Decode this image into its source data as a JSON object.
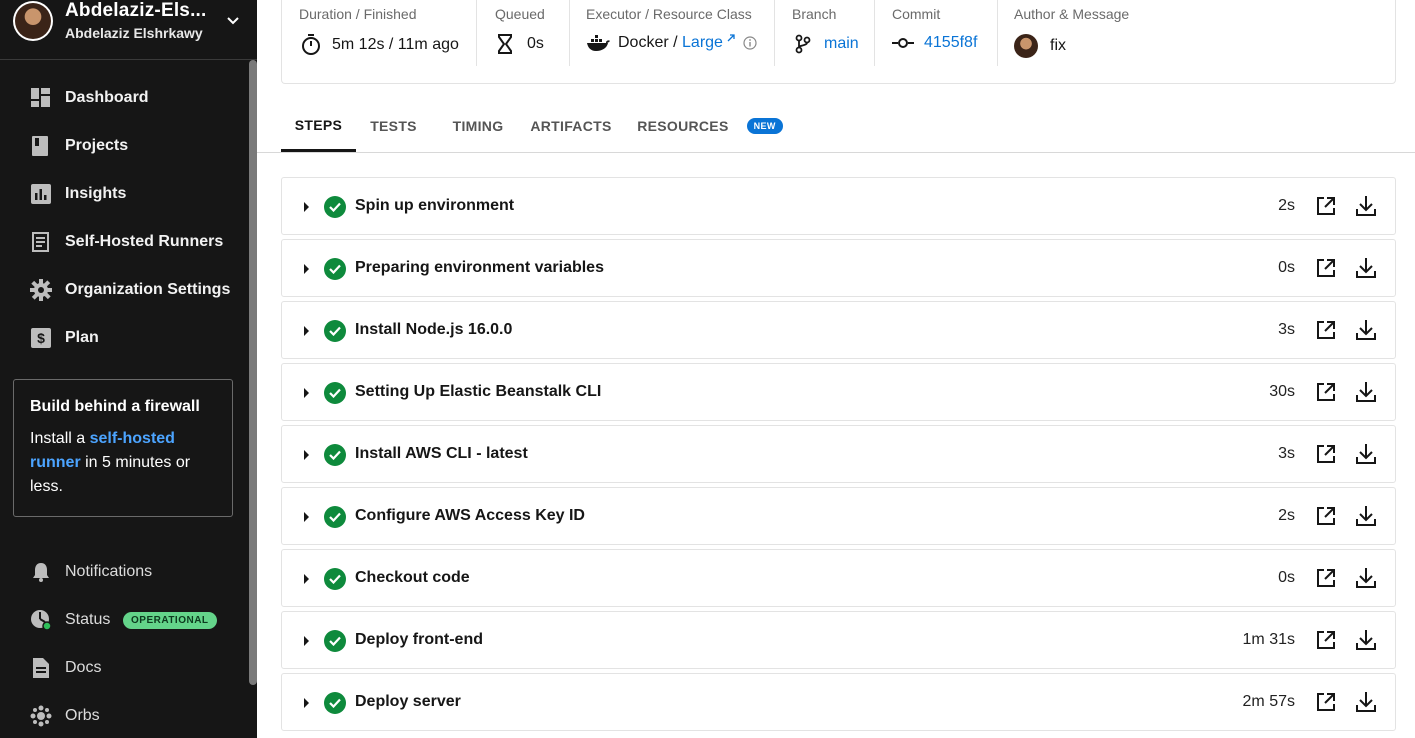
{
  "org": {
    "name": "Abdelaziz-Els...",
    "user": "Abdelaziz Elshrkawy"
  },
  "nav": [
    {
      "label": "Dashboard",
      "icon": "dashboard-icon"
    },
    {
      "label": "Projects",
      "icon": "projects-icon"
    },
    {
      "label": "Insights",
      "icon": "insights-icon"
    },
    {
      "label": "Self-Hosted Runners",
      "icon": "runners-icon"
    },
    {
      "label": "Organization Settings",
      "icon": "gear-icon"
    },
    {
      "label": "Plan",
      "icon": "dollar-icon"
    }
  ],
  "promo": {
    "heading": "Build behind a firewall",
    "text_before": "Install a ",
    "link": "self-hosted runner",
    "text_after": " in 5 minutes or less."
  },
  "bottom_nav": [
    {
      "label": "Notifications",
      "icon": "bell-icon"
    },
    {
      "label": "Status",
      "icon": "status-icon",
      "badge": "OPERATIONAL"
    },
    {
      "label": "Docs",
      "icon": "docs-icon"
    },
    {
      "label": "Orbs",
      "icon": "orbs-icon"
    }
  ],
  "info": {
    "duration": {
      "label": "Duration / Finished",
      "value": "5m 12s / 11m ago"
    },
    "queued": {
      "label": "Queued",
      "value": "0s"
    },
    "executor": {
      "label": "Executor / Resource Class",
      "executor": "Docker",
      "slash": " / ",
      "resource": "Large"
    },
    "branch": {
      "label": "Branch",
      "value": "main"
    },
    "commit": {
      "label": "Commit",
      "value": "4155f8f"
    },
    "author": {
      "label": "Author & Message",
      "message": "fix"
    }
  },
  "tabs": [
    {
      "label": "STEPS",
      "active": true
    },
    {
      "label": "TESTS"
    },
    {
      "label": "TIMING"
    },
    {
      "label": "ARTIFACTS"
    },
    {
      "label": "RESOURCES",
      "badge": "NEW"
    }
  ],
  "steps": [
    {
      "name": "Spin up environment",
      "duration": "2s"
    },
    {
      "name": "Preparing environment variables",
      "duration": "0s"
    },
    {
      "name": "Install Node.js 16.0.0",
      "duration": "3s"
    },
    {
      "name": "Setting Up Elastic Beanstalk CLI",
      "duration": "30s"
    },
    {
      "name": "Install AWS CLI - latest",
      "duration": "3s"
    },
    {
      "name": "Configure AWS Access Key ID",
      "duration": "2s"
    },
    {
      "name": "Checkout code",
      "duration": "0s"
    },
    {
      "name": "Deploy front-end",
      "duration": "1m 31s"
    },
    {
      "name": "Deploy server",
      "duration": "2m 57s"
    }
  ],
  "colors": {
    "sidebar_bg": "#161616",
    "link": "#0a74d6",
    "success": "#0e8a3c",
    "operational": "#64d48a"
  }
}
